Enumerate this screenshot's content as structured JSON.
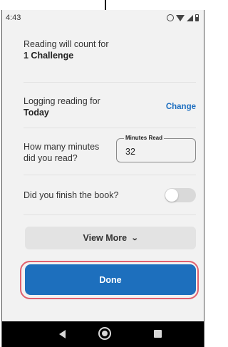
{
  "status_bar": {
    "time": "4:43",
    "icons": [
      "alarm-icon",
      "wifi-icon",
      "signal-icon",
      "battery-icon"
    ]
  },
  "challenge": {
    "label": "Reading will count for",
    "value": "1 Challenge"
  },
  "logging": {
    "label": "Logging reading for",
    "value": "Today",
    "action": "Change"
  },
  "minutes": {
    "question": "How many minutes did you read?",
    "field_label": "Minutes Read",
    "value": "32"
  },
  "finished": {
    "question": "Did you finish the book?",
    "toggle_on": false
  },
  "view_more": {
    "label": "View More",
    "icon": "chevron-down-icon"
  },
  "done": {
    "label": "Done"
  },
  "nav": {
    "icons": [
      "back-icon",
      "home-icon",
      "recent-apps-icon"
    ]
  },
  "colors": {
    "accent": "#1d6fbd",
    "highlight_ring": "#e0606e",
    "background": "#f2f2f2"
  }
}
